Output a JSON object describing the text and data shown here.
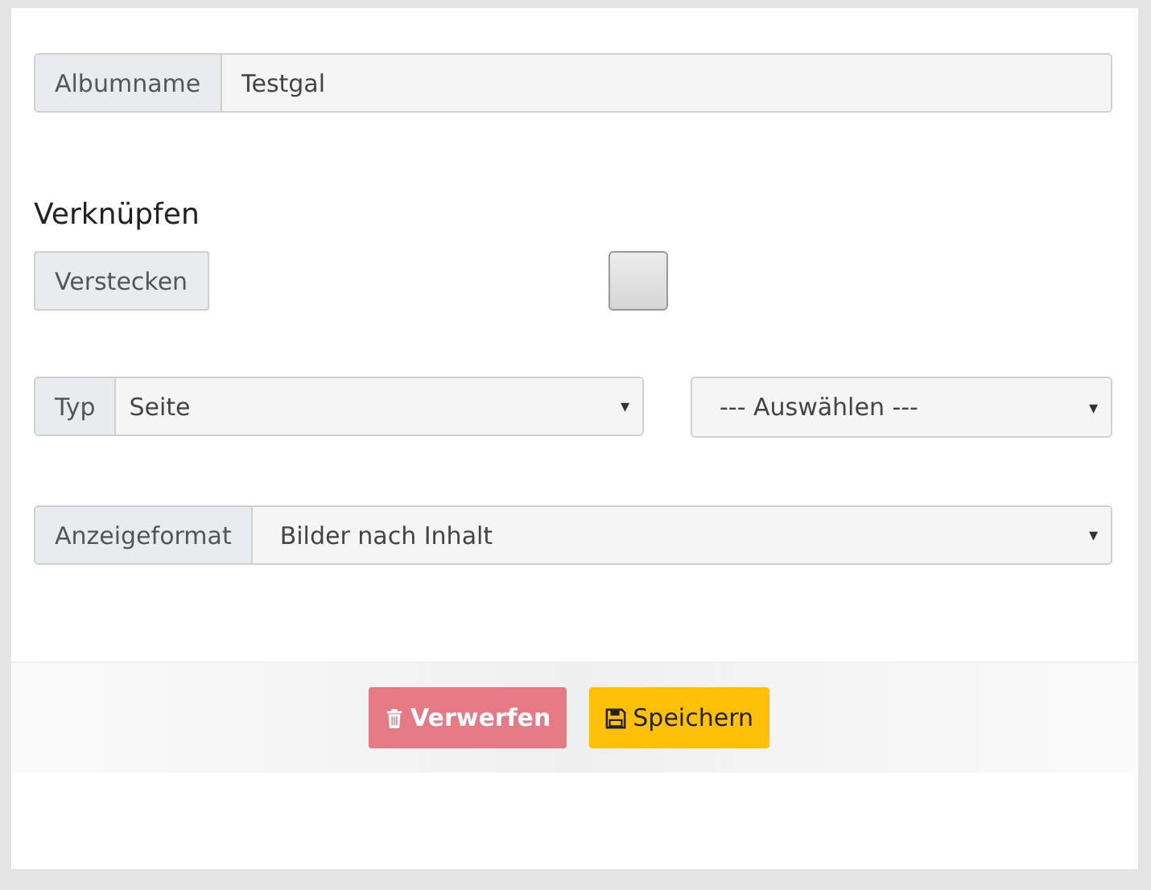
{
  "album": {
    "label": "Albumname",
    "value": "Testgal"
  },
  "section_title": "Verknüpfen",
  "hide": {
    "label": "Verstecken",
    "checked": false
  },
  "type": {
    "label": "Typ",
    "value": "Seite",
    "caret": "▾"
  },
  "target": {
    "value": "--- Auswählen ---",
    "caret": "▾"
  },
  "display": {
    "label": "Anzeigeformat",
    "value": "Bilder nach Inhalt",
    "caret": "▾"
  },
  "buttons": [
    {
      "kind": "discard",
      "label": "Verwerfen"
    },
    {
      "kind": "save",
      "label": "Speichern"
    }
  ]
}
